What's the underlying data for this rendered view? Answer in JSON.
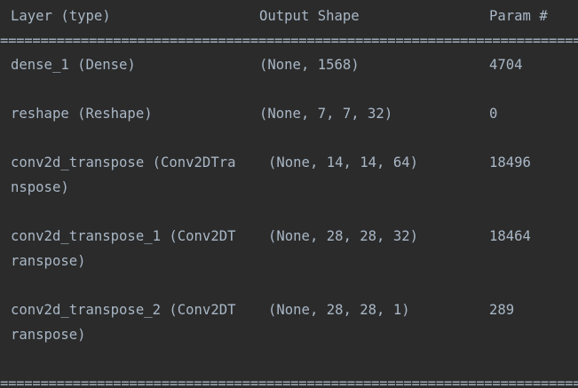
{
  "header": {
    "layer": "Layer (type)",
    "shape": "Output Shape",
    "param": "Param #"
  },
  "separator": "==========================================================================================================",
  "rows": [
    {
      "layer": "dense_1 (Dense)",
      "shape": "(None, 1568)",
      "param": "4704"
    },
    {
      "layer": "reshape (Reshape)",
      "shape": "(None, 7, 7, 32)",
      "param": "0"
    },
    {
      "layer": "conv2d_transpose (Conv2DTra",
      "layer_cont": "nspose)",
      "shape": "(None, 14, 14, 64)",
      "param": "18496"
    },
    {
      "layer": "conv2d_transpose_1 (Conv2DT",
      "layer_cont": "ranspose)",
      "shape": "(None, 28, 28, 32)",
      "param": "18464"
    },
    {
      "layer": "conv2d_transpose_2 (Conv2DT",
      "layer_cont": "ranspose)",
      "shape": "(None, 28, 28, 1)",
      "param": "289"
    }
  ]
}
